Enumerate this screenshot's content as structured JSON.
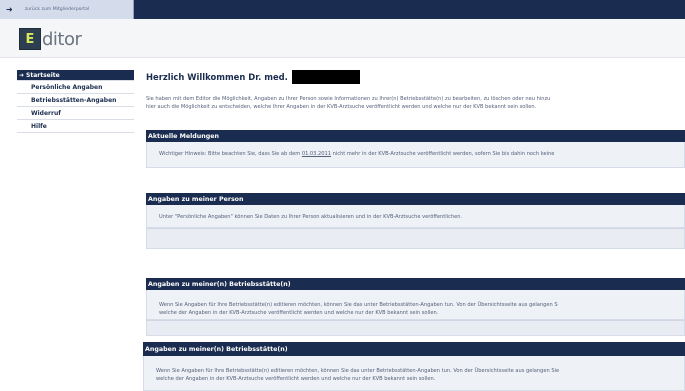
{
  "topbar": {
    "back_link": "zurück zum Mitgliederportal"
  },
  "header": {
    "logo_letter": "E",
    "logo_text": "ditor"
  },
  "sidebar": {
    "items": [
      {
        "label": "Startseite",
        "active": true
      },
      {
        "label": "Persönliche Angaben"
      },
      {
        "label": "Betriebsstätten-Angaben"
      },
      {
        "label": "Widerruf"
      },
      {
        "label": "Hilfe"
      }
    ]
  },
  "main": {
    "welcome": "Herzlich Willkommen Dr. med.",
    "intro_line1": "Sie haben mit dem Editor die Möglichkeit, Angaben zu Ihrer Person sowie Informationen zu Ihrer(n) Betriebsstätte(n) zu bearbeiten, zu löschen oder neu hinzu",
    "intro_line2": "hier auch die Möglichkeit zu entscheiden, welche Ihrer Angaben in der KVB-Arztsuche veröffentlicht werden und welche nur der KVB bekannt sein sollen."
  },
  "panels": {
    "meldungen": {
      "title": "Aktuelle Meldungen",
      "text_before": "Wichtiger Hinweis: Bitte beachten Sie, dass Sie ab dem ",
      "date": "01.03.2011",
      "text_after": " nicht mehr in der KVB-Arztsuche veröffentlicht werden, sofern Sie bis dahin noch keine"
    },
    "person": {
      "title": "Angaben zu meiner Person",
      "text": "Unter \"Persönliche Angaben\" können Sie Daten zu Ihrer Person aktualisieren und in der KVB-Arztsuche veröffentlichen."
    },
    "betrieb1": {
      "title": "Angaben zu meiner(n) Betriebsstätte(n)",
      "line1": "Wenn Sie Angaben für Ihre Betriebsstätte(n) editieren möchten, können Sie das unter Betriebsstätten-Angaben tun. Von der Übersichtsseite aus gelangen S",
      "line2": "welche der Angaben in der KVB-Arztsuche veröffentlicht werden und welche nur der KVB bekannt sein sollen."
    },
    "betrieb2": {
      "title": "Angaben zu meiner(n) Betriebsstätte(n)",
      "line1": "Wenn Sie Angaben für Ihre Betriebsstätte(n) editieren möchten, können Sie das unter Betriebsstätten-Angaben tun. Von der Übersichtsseite aus gelangen Sie",
      "line2": "welche der Angaben in der KVB-Arztsuche veröffentlicht werden und welche nur der KVB bekannt sein sollen."
    }
  },
  "colors": {
    "navy": "#1a2c4f",
    "panel_bg": "#eef1f6",
    "logo_accent": "#d8e85a"
  }
}
